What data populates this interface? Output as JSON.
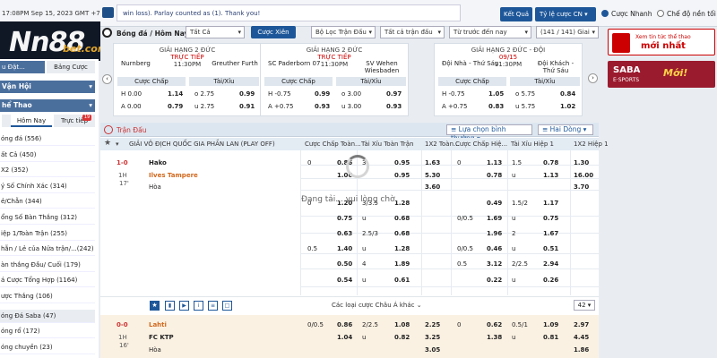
{
  "topbar": {
    "clock": "17:08PM Sep 15, 2023 GMT +7",
    "marquee": "win loss). Parlay counted as (1). Thank you!",
    "result_button": "Kết Quả",
    "odds_type": "Tỷ lệ cược CN",
    "quick_bet_label": "Cược Nhanh",
    "single_mode_label": "Chế độ nền tối"
  },
  "logo": {
    "main": "Nn88",
    "suffix": "bet.com"
  },
  "filters": {
    "sport": "Bóng đá / Hôm Nay",
    "all": "Tất Cả",
    "parlay_button": "Cược Xiên",
    "filter_matches": "Bộ Lọc Trận Đấu",
    "all_matches": "Tất cả trận đấu",
    "sort": "Từ trước đến nay",
    "page_info": "(141 / 141) Giai"
  },
  "sidebar": {
    "top_cut": "u Đặt...",
    "parlay_tab": "Bảng Cược",
    "section1": "Vận Hội",
    "section2": "hể Thao",
    "tabs": [
      "Hôm Nay",
      "Trực tiếp"
    ],
    "tabs_badge": "19",
    "items": [
      "óng đá (556)",
      "ất Cả (450)",
      "X2 (352)",
      "ý Số Chính Xác (314)",
      "ẻ/Chẵn (344)",
      "ổng Số Bàn Thắng (312)",
      "iệp 1/Toàn Trận (255)",
      "hẵn / Lẻ của Nửa trận/...(242)",
      "àn thắng Đầu/ Cuối (179)",
      "á Cược Tổng Hợp (1164)",
      "ược Thắng (106)",
      "óng Đá Saba (47)",
      "óng rổ (172)",
      "óng chuyền (23)"
    ]
  },
  "cards": [
    {
      "league": "GIẢI HẠNG 2 ĐỨC",
      "live": "TRỰC TIẾP",
      "time": "11:30PM",
      "home": "Nurnberg",
      "away": "Greuther Furth",
      "h1": "Cược Chấp",
      "h2": "Tài/Xỉu",
      "rows": [
        [
          "H 0.00",
          "1.14",
          "o 2.75",
          "0.99"
        ],
        [
          "A 0.00",
          "0.79",
          "u 2.75",
          "0.91"
        ]
      ]
    },
    {
      "league": "GIẢI HẠNG 2 ĐỨC",
      "live": "TRỰC TIẾP",
      "time": "11:30PM",
      "home": "SC Paderborn 07",
      "away": "SV Wehen Wiesbaden",
      "h1": "Cược Chấp",
      "h2": "Tài/Xỉu",
      "rows": [
        [
          "H -0.75",
          "0.99",
          "o 3.00",
          "0.97"
        ],
        [
          "A +0.75",
          "0.93",
          "u 3.00",
          "0.93"
        ]
      ]
    },
    {
      "league": "GIẢI HẠNG 2 ĐỨC - ĐỘI",
      "live": "09/15",
      "time": "11:30PM",
      "home": "Đội Nhà - Thứ Sáu",
      "away": "Đội Khách - Thứ Sáu",
      "h1": "Cược Chấp",
      "h2": "Tài/Xỉu",
      "rows": [
        [
          "H -0.75",
          "1.05",
          "o 5.75",
          "0.84"
        ],
        [
          "A +0.75",
          "0.83",
          "u 5.75",
          "1.02"
        ]
      ]
    }
  ],
  "banners": {
    "b1_line1": "Xem tin tức thể thao",
    "b1_line2": "mới nhất",
    "b2": "SABA",
    "b2b": "E·SPORTS",
    "b2c": "Mới!"
  },
  "main": {
    "header_left": "Trận Đấu",
    "sort_label": "Lựa chọn bình thường",
    "view_label": "Hai Dòng",
    "league": "GIẢI VÔ ĐỊCH QUỐC GIA PHẦN LAN (PLAY OFF)",
    "col_headers": [
      "Cược Chấp Toàn...",
      "Tài Xỉu Toàn Trận",
      "1X2 Toàn...",
      "Cược Chấp Hiệ...",
      "Tài Xỉu Hiệp 1",
      "1X2 Hiệp 1"
    ],
    "loading": "Đang tải... vui lòng chờ.",
    "more_label": "Các loại cược Châu Á khác",
    "more_count": "42",
    "match1": {
      "score": "1-0",
      "half": "1H",
      "minute": "17'",
      "home": "Hako",
      "away": "Ilves Tampere",
      "draw": "Hòa",
      "rows": [
        [
          "0",
          "0.86",
          "3",
          "0.95",
          "1.63",
          "0",
          "1.13",
          "1.5",
          "0.78",
          "1.30"
        ],
        [
          "",
          "1.06",
          "",
          "0.95",
          "5.30",
          "",
          "0.78",
          "u",
          "1.13",
          "16.00"
        ],
        [
          "",
          "",
          "",
          "",
          "3.60",
          "",
          "",
          "",
          "",
          "3.70"
        ],
        [
          "0",
          "1.20",
          "3/3.5",
          "1.28",
          "",
          "",
          "0.49",
          "1.5/2",
          "1.17",
          ""
        ],
        [
          "",
          "0.75",
          "u",
          "0.68",
          "",
          "0/0.5",
          "1.69",
          "u",
          "0.75",
          ""
        ],
        [
          "",
          "0.63",
          "2.5/3",
          "0.68",
          "",
          "",
          "1.96",
          "2",
          "1.67",
          ""
        ],
        [
          "0.5",
          "1.40",
          "u",
          "1.28",
          "",
          "0/0.5",
          "0.46",
          "u",
          "0.51",
          ""
        ],
        [
          "",
          "0.50",
          "4",
          "1.89",
          "",
          "0.5",
          "3.12",
          "2/2.5",
          "2.94",
          ""
        ],
        [
          "",
          "0.54",
          "u",
          "0.61",
          "",
          "",
          "0.22",
          "u",
          "0.26",
          ""
        ]
      ]
    },
    "match2": {
      "score": "0-0",
      "half": "1H",
      "minute": "16'",
      "home": "Lahti",
      "away": "FC KTP",
      "draw": "Hòa",
      "rows": [
        [
          "0/0.5",
          "0.86",
          "2/2.5",
          "1.08",
          "2.25",
          "0",
          "0.62",
          "0.5/1",
          "1.09",
          "2.97"
        ],
        [
          "",
          "1.04",
          "u",
          "0.82",
          "3.25",
          "",
          "1.38",
          "u",
          "0.81",
          "4.45"
        ],
        [
          "",
          "",
          "",
          "",
          "3.05",
          "",
          "",
          "",
          "",
          "1.86"
        ]
      ]
    }
  }
}
